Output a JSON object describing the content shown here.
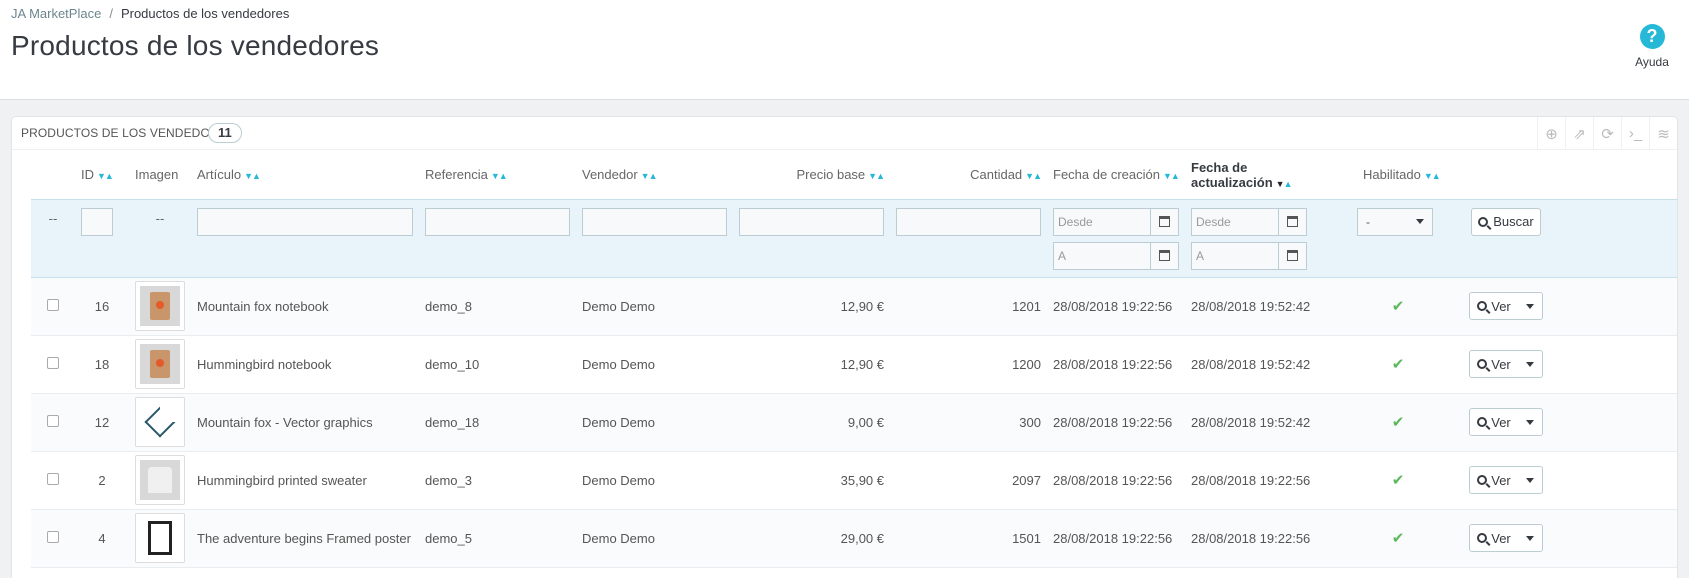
{
  "breadcrumb": {
    "root": "JA MarketPlace",
    "separator": "/",
    "current": "Productos de los vendedores"
  },
  "page_title": "Productos de los vendedores",
  "help": {
    "label": "Ayuda",
    "icon": "question-circle-icon",
    "color": "#25b9d7"
  },
  "panel": {
    "title": "Productos de los vendedores",
    "count": "11"
  },
  "toolbar": [
    {
      "name": "add-new-icon",
      "glyph": "⊕"
    },
    {
      "name": "export-icon",
      "glyph": "⇗"
    },
    {
      "name": "refresh-icon",
      "glyph": "⟳"
    },
    {
      "name": "sql-query-icon",
      "glyph": "›_"
    },
    {
      "name": "database-icon",
      "glyph": "≋"
    }
  ],
  "columns": {
    "id": "ID",
    "image": "Imagen",
    "article": "Artículo",
    "reference": "Referencia",
    "vendor": "Vendedor",
    "price": "Precio base",
    "quantity": "Cantidad",
    "created": "Fecha de creación",
    "updated": "Fecha de actualización",
    "enabled": "Habilitado"
  },
  "filters": {
    "select_dash": "--",
    "image_dash": "--",
    "date_from_placeholder": "Desde",
    "date_to_placeholder": "A",
    "enabled_value": "-",
    "search_label": "Buscar"
  },
  "rows": [
    {
      "id": "16",
      "article": "Mountain fox notebook",
      "reference": "demo_8",
      "vendor": "Demo Demo",
      "price": "12,90 €",
      "quantity": "1201",
      "created": "28/08/2018 19:22:56",
      "updated": "28/08/2018 19:52:42",
      "thumb": "notebook"
    },
    {
      "id": "18",
      "article": "Hummingbird notebook",
      "reference": "demo_10",
      "vendor": "Demo Demo",
      "price": "12,90 €",
      "quantity": "1200",
      "created": "28/08/2018 19:22:56",
      "updated": "28/08/2018 19:52:42",
      "thumb": "notebook"
    },
    {
      "id": "12",
      "article": "Mountain fox - Vector graphics",
      "reference": "demo_18",
      "vendor": "Demo Demo",
      "price": "9,00 €",
      "quantity": "300",
      "created": "28/08/2018 19:22:56",
      "updated": "28/08/2018 19:52:42",
      "thumb": "vector"
    },
    {
      "id": "2",
      "article": "Hummingbird printed sweater",
      "reference": "demo_3",
      "vendor": "Demo Demo",
      "price": "35,90 €",
      "quantity": "2097",
      "created": "28/08/2018 19:22:56",
      "updated": "28/08/2018 19:22:56",
      "thumb": "sweater"
    },
    {
      "id": "4",
      "article": "The adventure begins Framed poster",
      "reference": "demo_5",
      "vendor": "Demo Demo",
      "price": "29,00 €",
      "quantity": "1501",
      "created": "28/08/2018 19:22:56",
      "updated": "28/08/2018 19:22:56",
      "thumb": "poster"
    }
  ],
  "row_action": {
    "label": "Ver",
    "icon": "zoom-icon"
  },
  "enabled_icon": "check-icon"
}
